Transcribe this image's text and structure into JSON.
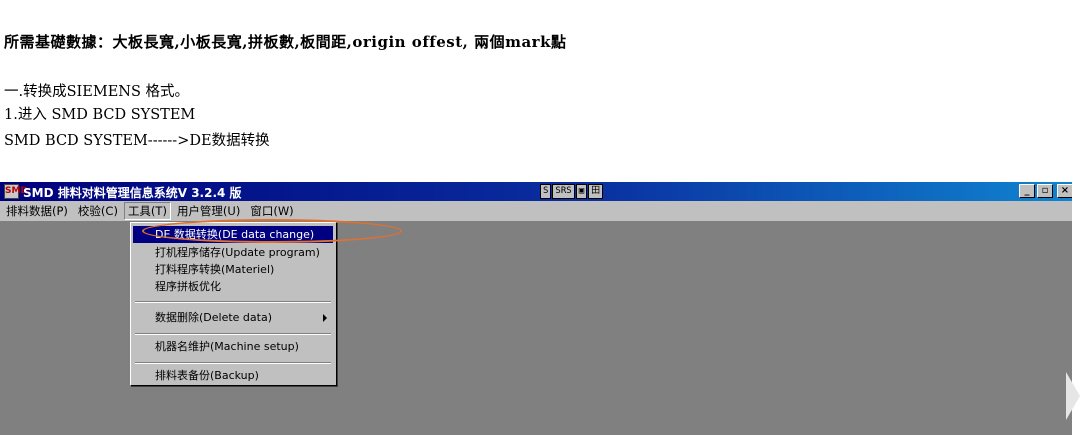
{
  "document": {
    "heading": "所需基礎數據：大板長寬,小板長寬,拼板數,板間距,origin offest, 兩個mark點",
    "lines": [
      "一.转换成SIEMENS 格式。",
      "1.进入 SMD BCD SYSTEM",
      "SMD BCD SYSTEM------>DE数据转换"
    ]
  },
  "window": {
    "title": "SMD 排料对料管理信息系统V 3.2.4 版",
    "app_icon_label": "SMD",
    "title_icons": [
      "S",
      "SRS",
      "▣",
      "田"
    ],
    "controls": {
      "minimize": "_",
      "maximize": "▫",
      "close": "×"
    },
    "menu": [
      {
        "label": "排料数据(P)"
      },
      {
        "label": "校验(C)"
      },
      {
        "label": "工具(T)"
      },
      {
        "label": "用户管理(U)"
      },
      {
        "label": "窗口(W)"
      }
    ],
    "active_menu_index": 2,
    "dropdown_items": [
      {
        "label": "DE 数据转换(DE data change)",
        "selected": true
      },
      {
        "label": "打机程序储存(Update program)"
      },
      {
        "label": "打料程序转换(Materiel)"
      },
      {
        "label": "程序拼板优化"
      },
      {
        "label": "数据删除(Delete data)",
        "submenu": true
      },
      {
        "label": "机器名维护(Machine setup)"
      },
      {
        "label": "排料表备份(Backup)"
      }
    ],
    "accent_colors": {
      "title_bar": "#00007b",
      "selection": "#000080",
      "highlight_ellipse": "#e07030",
      "workspace": "#808080"
    }
  }
}
